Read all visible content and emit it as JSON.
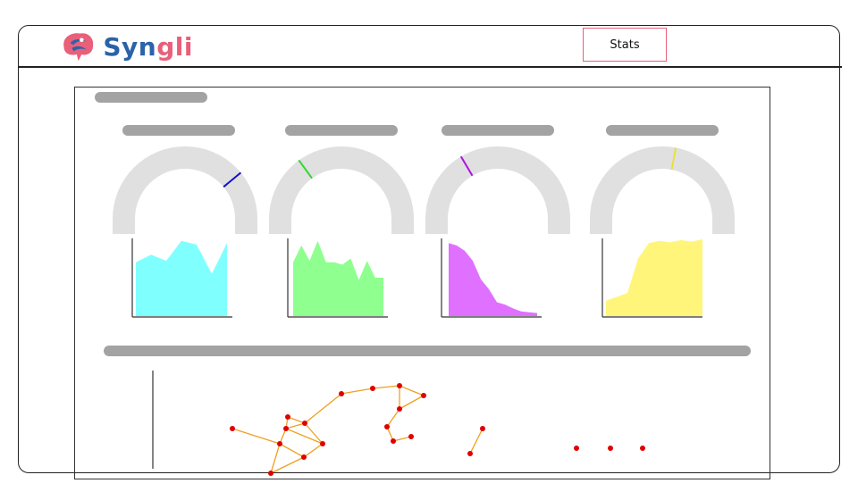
{
  "app": {
    "brand_part1": "Syn",
    "brand_part2": "gli",
    "nav_stats": "Stats",
    "logo_icon": "brain-icon"
  },
  "colors": {
    "brand_blue": "#2a63a8",
    "brand_pink": "#e8607a",
    "gauge_track": "#e0e0e0",
    "placeholder": "#a3a3a3",
    "network_node": "#e00000",
    "network_edge": "#f0a020"
  },
  "gauges": [
    {
      "needle_color": "#1010d0",
      "fill_color": "#80ffff",
      "value_fraction": 0.78
    },
    {
      "needle_color": "#30d830",
      "fill_color": "#8fff8f",
      "value_fraction": 0.3
    },
    {
      "needle_color": "#b010e0",
      "fill_color": "#e070ff",
      "value_fraction": 0.33
    },
    {
      "needle_color": "#e8e040",
      "fill_color": "#fff57a",
      "value_fraction": 0.56
    }
  ],
  "chart_data": [
    {
      "type": "area",
      "series": [
        {
          "values": [
            0.7,
            0.8,
            0.72,
            0.98,
            0.93,
            0.55,
            0.95
          ]
        }
      ],
      "ylim": [
        0,
        1
      ]
    },
    {
      "type": "area",
      "series": [
        {
          "values": [
            0.7,
            0.92,
            0.72,
            0.98,
            0.7,
            0.7,
            0.67,
            0.75,
            0.47,
            0.72,
            0.5,
            0.5
          ]
        }
      ],
      "ylim": [
        0,
        1
      ]
    },
    {
      "type": "area",
      "series": [
        {
          "values": [
            0.95,
            0.92,
            0.85,
            0.72,
            0.48,
            0.35,
            0.18,
            0.15,
            0.1,
            0.06,
            0.05,
            0.04
          ]
        }
      ],
      "ylim": [
        0,
        1
      ]
    },
    {
      "type": "area",
      "series": [
        {
          "values": [
            0.2,
            0.25,
            0.3,
            0.75,
            0.95,
            0.98,
            0.96,
            0.99,
            0.97,
            1.0
          ]
        }
      ],
      "ylim": [
        0,
        1
      ]
    }
  ]
}
